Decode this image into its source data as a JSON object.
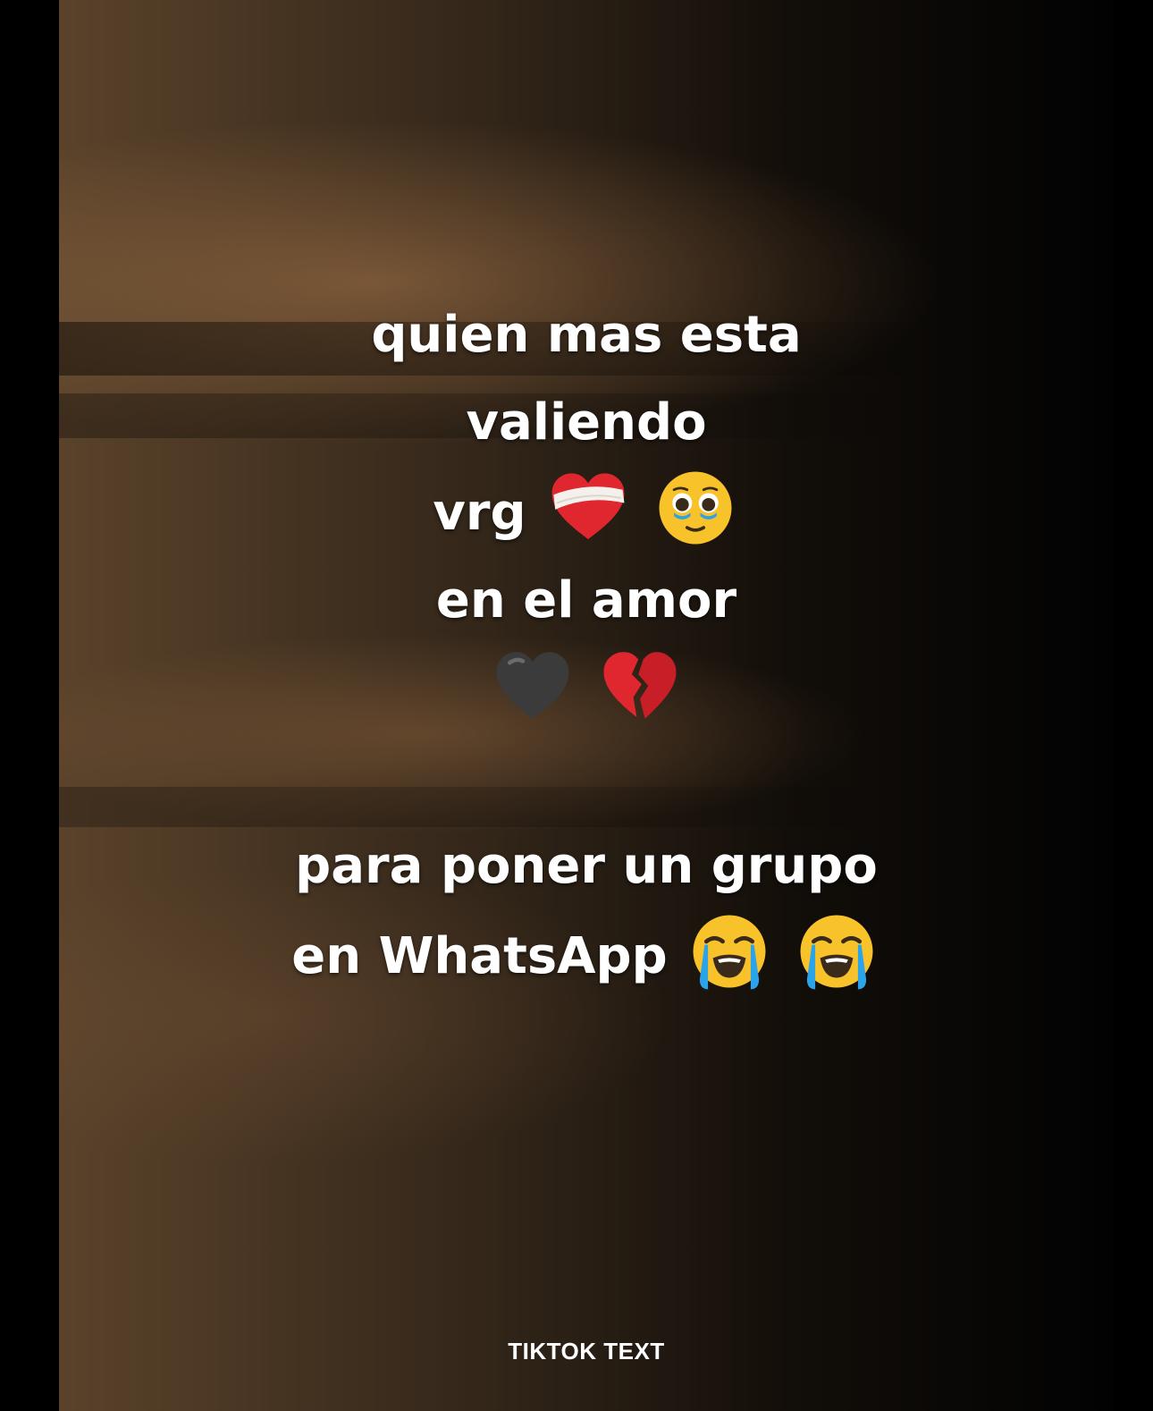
{
  "caption": {
    "lines_top": [
      "quien mas esta",
      "valiendo",
      "vrg",
      "en el amor"
    ],
    "lines_bottom": [
      "para poner un grupo",
      "en WhatsApp"
    ]
  },
  "emojis": {
    "line3": [
      "mending-heart-icon",
      "holding-back-tears-icon"
    ],
    "line5": [
      "black-heart-icon",
      "broken-heart-icon"
    ],
    "bottom": [
      "loudly-crying-icon",
      "loudly-crying-icon"
    ]
  },
  "watermark": "TIKTOK TEXT",
  "colors": {
    "text": "#ffffff",
    "background_left": "#5f462d",
    "background_right": "#020202",
    "heart_red": "#e0262f",
    "emoji_yellow": "#f8c22a",
    "tear_blue": "#2aa3ea",
    "black_heart": "#3b3b3b"
  }
}
